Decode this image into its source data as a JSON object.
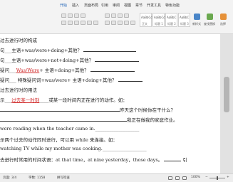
{
  "menu": {
    "items": [
      "开始",
      "插入",
      "页面布局",
      "引用",
      "审阅",
      "视图",
      "章节",
      "开发工具",
      "特色功能"
    ]
  },
  "ribbon": {
    "styles": [
      {
        "sample": "AaBbCcDd",
        "name": "正文"
      },
      {
        "sample": "AaBbCcDd",
        "name": "标题 1"
      },
      {
        "sample": "AaBbC",
        "name": "标题 2"
      },
      {
        "sample": "AaBbC",
        "name": "标题 3"
      }
    ],
    "new_style_label": "新样式",
    "find_label": "查找替换",
    "select_label": "选择"
  },
  "document": {
    "lines": [
      {
        "id": "l1",
        "parts": [
          "过去进行时的构成"
        ]
      },
      {
        "id": "l2",
        "parts": [
          "句___主语+was/were+doing+其他？"
        ]
      },
      {
        "id": "l3",
        "parts": [
          "句___主语+was/were+not+doing+其他？"
        ]
      },
      {
        "id": "l4",
        "parts": [
          "疑问___",
          "Was/Were",
          "+ 主语+doing+其他？"
        ]
      },
      {
        "id": "l5",
        "parts": [
          "疑问___ 特殊疑问词+was/were+ 主语+doing+其他？"
        ]
      },
      {
        "id": "l6",
        "parts": [
          "过去进行时的用法"
        ]
      },
      {
        "id": "l7",
        "parts": [
          "示___",
          "过去某一时刻",
          "____或某一段时间内正在进行的动作。如："
        ]
      },
      {
        "id": "l8",
        "parts": [
          "昨天这个时候你在干什么？"
        ]
      },
      {
        "id": "l9",
        "parts": [
          "我正在做我的家庭作业。"
        ]
      },
      {
        "id": "l10",
        "parts": [
          "were reading when the teacher came in.___________________"
        ]
      },
      {
        "id": "l11",
        "parts": [
          "示两个过去的动作同时进行，可以用 while 来连接。如："
        ]
      },
      {
        "id": "l12",
        "parts": [
          "watching TV while my mother was cooking.___________________"
        ]
      },
      {
        "id": "l13",
        "parts": [
          "去进行时常用的时间状语：at that time，at nine yesterday，those days。",
          "引"
        ]
      }
    ]
  },
  "status": {
    "page": "页面: 3/4",
    "words": "字数: 1158",
    "spell": "拼写检查",
    "zoom": "100%"
  }
}
